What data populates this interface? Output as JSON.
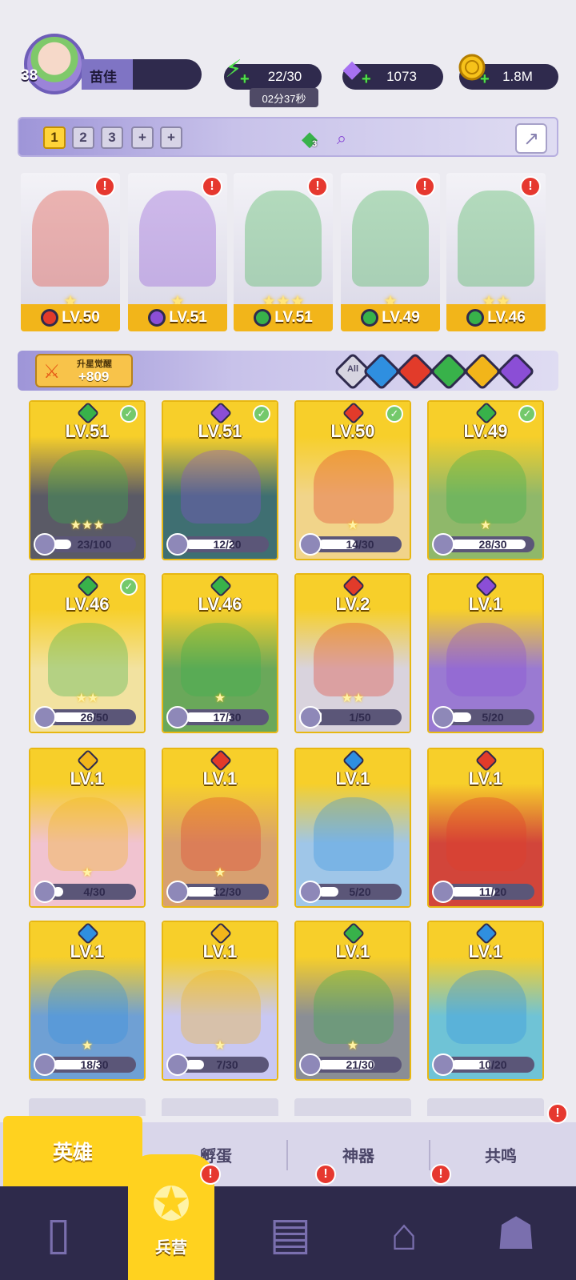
{
  "player": {
    "level": "38",
    "name": "苗佳"
  },
  "resources": {
    "energy": "22/30",
    "energy_timer": "02分37秒",
    "gems": "1073",
    "gold": "1.8M"
  },
  "team_bar": {
    "tabs": [
      "1",
      "2",
      "3",
      "+",
      "+"
    ],
    "active_tab": "1",
    "gem_count": "3"
  },
  "lineup": [
    {
      "level": "LV.50",
      "element": "fire",
      "color": "#e23b2a",
      "stars": "★",
      "alert": "!"
    },
    {
      "level": "LV.51",
      "element": "dark",
      "color": "#8b4ed6",
      "stars": "★",
      "alert": "!"
    },
    {
      "level": "LV.51",
      "element": "nature",
      "color": "#38b24a",
      "stars": "★★★",
      "alert": "!"
    },
    {
      "level": "LV.49",
      "element": "nature",
      "color": "#38b24a",
      "stars": "★",
      "alert": "!"
    },
    {
      "level": "LV.46",
      "element": "nature",
      "color": "#38b24a",
      "stars": "★★",
      "alert": "!"
    }
  ],
  "filter_bar": {
    "awaken_label": "升星觉醒",
    "awaken_value": "+809",
    "all_label": "All",
    "filters": [
      {
        "name": "water",
        "color": "#2f8fe0"
      },
      {
        "name": "fire",
        "color": "#e23b2a"
      },
      {
        "name": "nature",
        "color": "#38b24a"
      },
      {
        "name": "light",
        "color": "#f2b51a"
      },
      {
        "name": "dark",
        "color": "#8b4ed6"
      }
    ]
  },
  "heroes": [
    {
      "level": "LV.51",
      "element": "nature",
      "color": "#38b24a",
      "progress": "23/100",
      "fraction": 0.23,
      "checked": true,
      "stars": "★★★",
      "bg": "#5a5a66"
    },
    {
      "level": "LV.51",
      "element": "dark",
      "color": "#8b4ed6",
      "progress": "12/20",
      "fraction": 0.6,
      "checked": true,
      "stars": "",
      "bg": "#3f6f72"
    },
    {
      "level": "LV.50",
      "element": "fire",
      "color": "#e23b2a",
      "progress": "14/30",
      "fraction": 0.47,
      "checked": true,
      "stars": "★",
      "bg": "#f1d48a"
    },
    {
      "level": "LV.49",
      "element": "nature",
      "color": "#38b24a",
      "progress": "28/30",
      "fraction": 0.93,
      "checked": true,
      "stars": "★",
      "bg": "#8fb86a"
    },
    {
      "level": "LV.46",
      "element": "nature",
      "color": "#38b24a",
      "progress": "26/50",
      "fraction": 0.52,
      "checked": true,
      "stars": "★★",
      "bg": "#f2e2a0"
    },
    {
      "level": "LV.46",
      "element": "nature",
      "color": "#38b24a",
      "progress": "17/30",
      "fraction": 0.57,
      "checked": false,
      "stars": "★",
      "bg": "#6aa85a"
    },
    {
      "level": "LV.2",
      "element": "fire",
      "color": "#e23b2a",
      "progress": "1/50",
      "fraction": 0.02,
      "checked": false,
      "stars": "★★",
      "bg": "#d9d3dd"
    },
    {
      "level": "LV.1",
      "element": "dark",
      "color": "#8b4ed6",
      "progress": "5/20",
      "fraction": 0.25,
      "checked": false,
      "stars": "",
      "bg": "#9a7ad2"
    },
    {
      "level": "LV.1",
      "element": "light",
      "color": "#f2b51a",
      "progress": "4/30",
      "fraction": 0.13,
      "checked": false,
      "stars": "★",
      "bg": "#f1c3d0"
    },
    {
      "level": "LV.1",
      "element": "fire",
      "color": "#e23b2a",
      "progress": "12/30",
      "fraction": 0.4,
      "checked": false,
      "stars": "★",
      "bg": "#d8a070"
    },
    {
      "level": "LV.1",
      "element": "water",
      "color": "#2f8fe0",
      "progress": "5/20",
      "fraction": 0.25,
      "checked": false,
      "stars": "",
      "bg": "#9fc6e8"
    },
    {
      "level": "LV.1",
      "element": "fire",
      "color": "#e23b2a",
      "progress": "11/20",
      "fraction": 0.55,
      "checked": false,
      "stars": "",
      "bg": "#d2453a"
    },
    {
      "level": "LV.1",
      "element": "water",
      "color": "#2f8fe0",
      "progress": "18/30",
      "fraction": 0.6,
      "checked": false,
      "stars": "★",
      "bg": "#6fa0d4"
    },
    {
      "level": "LV.1",
      "element": "light",
      "color": "#f2b51a",
      "progress": "7/30",
      "fraction": 0.23,
      "checked": false,
      "stars": "★",
      "bg": "#c9c8f2"
    },
    {
      "level": "LV.1",
      "element": "nature",
      "color": "#38b24a",
      "progress": "21/30",
      "fraction": 0.7,
      "checked": false,
      "stars": "★",
      "bg": "#8a8e95"
    },
    {
      "level": "LV.1",
      "element": "water",
      "color": "#2f8fe0",
      "progress": "10/20",
      "fraction": 0.5,
      "checked": false,
      "stars": "",
      "bg": "#6fc3d6"
    }
  ],
  "subtabs": [
    {
      "label": "英雄",
      "active": true
    },
    {
      "label": "孵蛋",
      "active": false
    },
    {
      "label": "神器",
      "active": false
    },
    {
      "label": "共鸣",
      "active": false,
      "alert": "!"
    }
  ],
  "bottom_nav": [
    {
      "icon": "cards-icon",
      "label": "",
      "active": false
    },
    {
      "icon": "barracks-icon",
      "label": "兵营",
      "active": true,
      "alert": "!"
    },
    {
      "icon": "map-book-icon",
      "label": "",
      "active": false,
      "alert": "!"
    },
    {
      "icon": "castle-icon",
      "label": "",
      "active": false,
      "alert": "!"
    },
    {
      "icon": "mushroom-icon",
      "label": "",
      "active": false
    }
  ]
}
